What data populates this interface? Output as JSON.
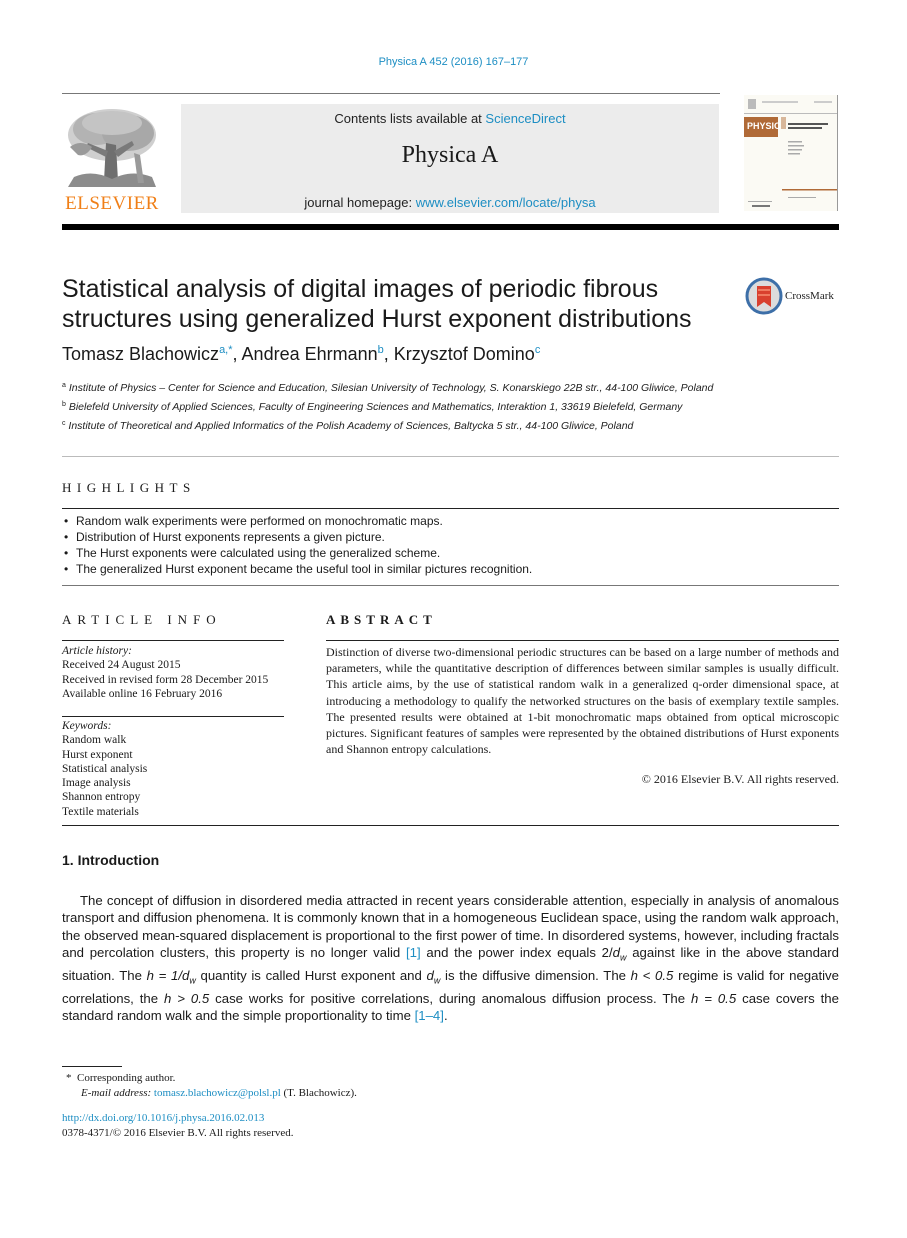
{
  "header": {
    "citation": "Physica A 452 (2016) 167–177",
    "contents_prefix": "Contents lists available at ",
    "contents_link": "ScienceDirect",
    "journal_name": "Physica A",
    "homepage_prefix": "journal homepage: ",
    "homepage_link": "www.elsevier.com/locate/physa",
    "publisher_logo_text": "ELSEVIER",
    "cover_title": "PHYSICA",
    "cover_subtitle": "STATISTICAL MECHANICS AND ITS APPLICATIONS"
  },
  "article": {
    "title": "Statistical analysis of digital images of periodic fibrous structures using generalized Hurst exponent distributions",
    "crossmark_label": "CrossMark",
    "authors": [
      {
        "name": "Tomasz Blachowicz",
        "sup": "a,*"
      },
      {
        "name": "Andrea Ehrmann",
        "sup": "b"
      },
      {
        "name": "Krzysztof Domino",
        "sup": "c"
      }
    ],
    "affiliations": [
      {
        "mark": "a",
        "text": "Institute of Physics – Center for Science and Education, Silesian University of Technology, S. Konarskiego 22B str., 44-100 Gliwice, Poland"
      },
      {
        "mark": "b",
        "text": "Bielefeld University of Applied Sciences, Faculty of Engineering Sciences and Mathematics, Interaktion 1, 33619 Bielefeld, Germany"
      },
      {
        "mark": "c",
        "text": "Institute of Theoretical and Applied Informatics of the Polish Academy of Sciences, Baltycka 5 str., 44-100 Gliwice, Poland"
      }
    ]
  },
  "highlights": {
    "heading": "HIGHLIGHTS",
    "items": [
      "Random walk experiments were performed on monochromatic maps.",
      "Distribution of Hurst exponents represents a given picture.",
      "The Hurst exponents were calculated using the generalized scheme.",
      "The generalized Hurst exponent became the useful tool in similar pictures recognition."
    ]
  },
  "article_info": {
    "heading": "ARTICLE INFO",
    "history_label": "Article history:",
    "history": [
      "Received 24 August 2015",
      "Received in revised form 28 December 2015",
      "Available online 16 February 2016"
    ],
    "keywords_label": "Keywords:",
    "keywords": [
      "Random walk",
      "Hurst exponent",
      "Statistical analysis",
      "Image analysis",
      "Shannon entropy",
      "Textile materials"
    ]
  },
  "abstract": {
    "heading": "ABSTRACT",
    "text": "Distinction of diverse two-dimensional periodic structures can be based on a large number of methods and parameters, while the quantitative description of differences between similar samples is usually difficult. This article aims, by the use of statistical random walk in a generalized q-order dimensional space, at introducing a methodology to qualify the networked structures on the basis of exemplary textile samples. The presented results were obtained at 1-bit monochromatic maps obtained from optical microscopic pictures. Significant features of samples were represented by the obtained distributions of Hurst exponents and Shannon entropy calculations.",
    "copyright": "© 2016 Elsevier B.V. All rights reserved."
  },
  "introduction": {
    "heading": "1.  Introduction",
    "p1_a": "The concept of diffusion in disordered media attracted in recent years considerable attention, especially in analysis of anomalous transport and diffusion phenomena. It is commonly known that in a homogeneous Euclidean space, using the random walk approach, the observed mean-squared displacement is proportional to the first power of time. In disordered systems, however, including fractals and percolation clusters, this property is no longer valid ",
    "ref1": "[1]",
    "p1_b": " and the power index equals 2/",
    "p1_c": " against like in the above standard situation. The ",
    "eq1": "h = 1/d",
    "p1_d": " quantity is called Hurst exponent and ",
    "p1_e": " is the diffusive dimension. The ",
    "eq2": "h < 0.5",
    "p1_f": " regime is valid for negative correlations, the ",
    "eq3": "h > 0.5",
    "p1_g": " case works for positive correlations, during anomalous diffusion process. The ",
    "eq4": "h = 0.5",
    "p1_h": " case covers the standard random walk and the simple proportionality to time ",
    "ref2": "[1–4]",
    "p1_end": ".",
    "d_symbol": "d",
    "w_sub": "w"
  },
  "footnotes": {
    "star": "*",
    "corresponding": "Corresponding author.",
    "email_label": "E-mail address:",
    "email": "tomasz.blachowicz@polsl.pl",
    "email_owner": " (T. Blachowicz).",
    "doi": "http://dx.doi.org/10.1016/j.physa.2016.02.013",
    "issn_copyright": "0378-4371/© 2016 Elsevier B.V. All rights reserved."
  },
  "colors": {
    "link": "#1d8ec3",
    "elsevier_orange": "#f07f17",
    "journal_box": "#ececec",
    "cover_band": "#b06a37"
  }
}
